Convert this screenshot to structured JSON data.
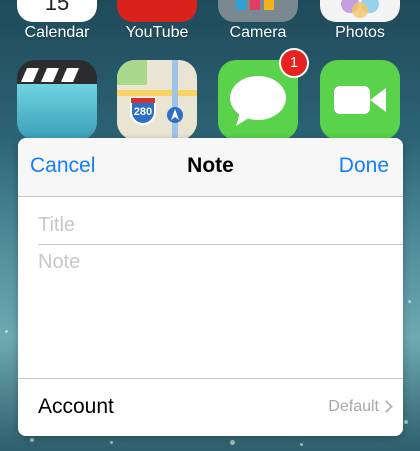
{
  "home_screen": {
    "apps_row1": [
      {
        "label": "Calendar",
        "icon": "calendar-icon"
      },
      {
        "label": "YouTube",
        "icon": "youtube-icon"
      },
      {
        "label": "Camera",
        "icon": "camera-icon"
      },
      {
        "label": "Photos",
        "icon": "photos-icon"
      }
    ],
    "apps_row2": [
      {
        "icon": "videos-icon"
      },
      {
        "icon": "maps-icon",
        "highway_shield": "280"
      },
      {
        "icon": "messages-icon",
        "badge": "1"
      },
      {
        "icon": "facetime-icon"
      }
    ]
  },
  "note_sheet": {
    "cancel_label": "Cancel",
    "title": "Note",
    "done_label": "Done",
    "title_placeholder": "Title",
    "note_placeholder": "Note",
    "account_label": "Account",
    "account_value": "Default"
  },
  "colors": {
    "accent": "#157efb",
    "badge": "#e8231f",
    "placeholder": "#c7c7cd"
  }
}
